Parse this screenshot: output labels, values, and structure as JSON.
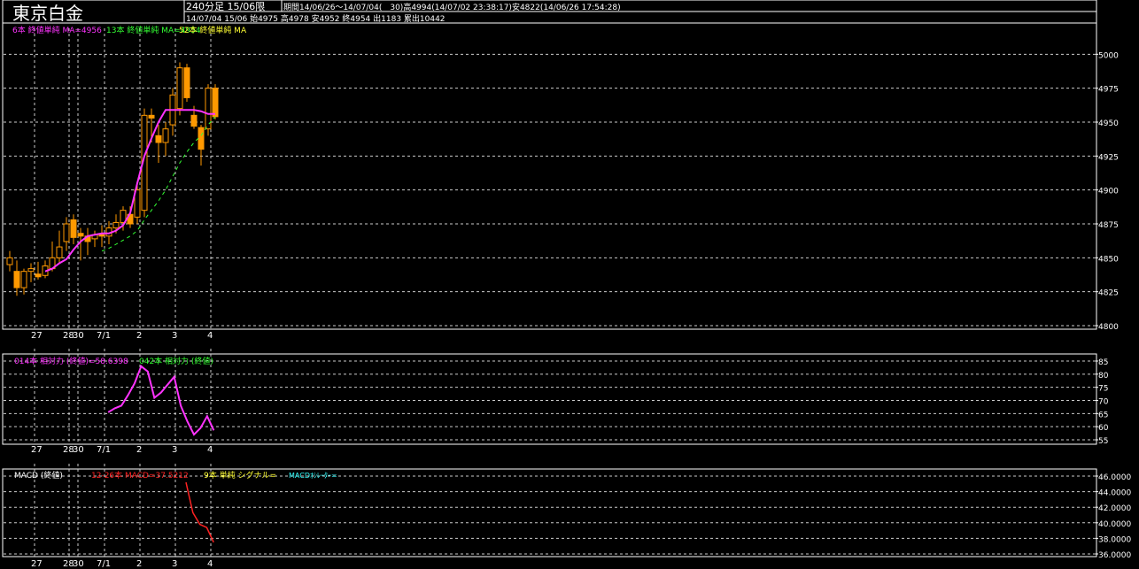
{
  "header": {
    "title": "東京白金",
    "timeframe": "240分足 15/06限",
    "period_info": "期間14/06/26～14/07/04(　30)高4994(14/07/02 23:38:17)安4822(14/06/26 17:54:28)",
    "last_bar": "14/07/04 15/06 始4975 高4978 安4952 終4954 出1183 累出10442"
  },
  "legends": {
    "price": [
      {
        "text": "6本 終値単純 MA=4956",
        "color": "#ff33ff"
      },
      {
        "text": "13本 終値単純 MA=4954",
        "color": "#33ff33"
      },
      {
        "text": "52本 終値単純 MA",
        "color": "#ffff33"
      }
    ],
    "rsi": [
      {
        "text": "014本 相対力 (終値)=58.6398",
        "color": "#ff33ff"
      },
      {
        "text": "042本 相対力 (終値)",
        "color": "#33ff33"
      }
    ],
    "macd": [
      {
        "text": "MACD (終値)",
        "color": "#ffffff"
      },
      {
        "text": "12-26本 MACD=37.5212",
        "color": "#ff2222"
      },
      {
        "text": "9本 単純 シグナル=",
        "color": "#ffff33"
      },
      {
        "text": "MACDｵｼﾚｰﾀｰ=",
        "color": "#33ffff"
      }
    ]
  },
  "colors": {
    "background": "#000000",
    "frame": "#ffffff",
    "grid": "#cccccc",
    "candle_down": "#ff9900",
    "candle_up_outline": "#ff9900",
    "ma_short": "#ff33ff",
    "ma_mid": "#33ff33",
    "rsi": "#ff33ff",
    "macd": "#ff2222"
  },
  "chart_data": [
    {
      "type": "candlestick",
      "panel": "price",
      "ylim": [
        4800,
        5010
      ],
      "y_ticks": [
        "5000",
        "4975",
        "4950",
        "4925",
        "4900",
        "4875",
        "4850",
        "4825",
        "4800"
      ],
      "x_labels": [
        "27",
        "28",
        "30",
        "7/1",
        "2",
        "3",
        "4"
      ],
      "grid": true,
      "candles": [
        {
          "o": 4845,
          "h": 4855,
          "l": 4840,
          "c": 4850
        },
        {
          "o": 4840,
          "h": 4848,
          "l": 4822,
          "c": 4828
        },
        {
          "o": 4828,
          "h": 4842,
          "l": 4823,
          "c": 4840
        },
        {
          "o": 4840,
          "h": 4846,
          "l": 4832,
          "c": 4842
        },
        {
          "o": 4838,
          "h": 4847,
          "l": 4834,
          "c": 4836
        },
        {
          "o": 4837,
          "h": 4848,
          "l": 4835,
          "c": 4844
        },
        {
          "o": 4842,
          "h": 4862,
          "l": 4840,
          "c": 4850
        },
        {
          "o": 4850,
          "h": 4870,
          "l": 4846,
          "c": 4858
        },
        {
          "o": 4862,
          "h": 4880,
          "l": 4855,
          "c": 4875
        },
        {
          "o": 4878,
          "h": 4882,
          "l": 4860,
          "c": 4865
        },
        {
          "o": 4868,
          "h": 4872,
          "l": 4848,
          "c": 4866
        },
        {
          "o": 4866,
          "h": 4872,
          "l": 4852,
          "c": 4862
        },
        {
          "o": 4864,
          "h": 4870,
          "l": 4858,
          "c": 4867
        },
        {
          "o": 4867,
          "h": 4874,
          "l": 4858,
          "c": 4866
        },
        {
          "o": 4866,
          "h": 4877,
          "l": 4860,
          "c": 4872
        },
        {
          "o": 4872,
          "h": 4882,
          "l": 4868,
          "c": 4876
        },
        {
          "o": 4876,
          "h": 4888,
          "l": 4870,
          "c": 4885
        },
        {
          "o": 4882,
          "h": 4888,
          "l": 4872,
          "c": 4875
        },
        {
          "o": 4880,
          "h": 4905,
          "l": 4875,
          "c": 4900
        },
        {
          "o": 4885,
          "h": 4960,
          "l": 4880,
          "c": 4955
        },
        {
          "o": 4955,
          "h": 4960,
          "l": 4935,
          "c": 4953
        },
        {
          "o": 4940,
          "h": 4948,
          "l": 4920,
          "c": 4935
        },
        {
          "o": 4935,
          "h": 4950,
          "l": 4925,
          "c": 4945
        },
        {
          "o": 4948,
          "h": 4975,
          "l": 4940,
          "c": 4970
        },
        {
          "o": 4960,
          "h": 4994,
          "l": 4955,
          "c": 4990
        },
        {
          "o": 4990,
          "h": 4993,
          "l": 4965,
          "c": 4968
        },
        {
          "o": 4955,
          "h": 4962,
          "l": 4945,
          "c": 4947
        },
        {
          "o": 4946,
          "h": 4948,
          "l": 4918,
          "c": 4930
        },
        {
          "o": 4945,
          "h": 4978,
          "l": 4940,
          "c": 4975
        },
        {
          "o": 4975,
          "h": 4978,
          "l": 4952,
          "c": 4954
        }
      ],
      "ma6": [
        null,
        null,
        null,
        null,
        null,
        4840,
        4842,
        4846,
        4849,
        4856,
        4862,
        4866,
        4867,
        4868,
        4868,
        4870,
        4874,
        4883,
        4905,
        4925,
        4938,
        4950,
        4959,
        4959,
        4959,
        4959,
        4959,
        4958,
        4956,
        4956
      ],
      "ma13": [
        null,
        null,
        null,
        null,
        null,
        null,
        null,
        null,
        null,
        null,
        null,
        null,
        null,
        4855,
        4857,
        4860,
        4863,
        4866,
        4870,
        4878,
        4885,
        4892,
        4900,
        4910,
        4920,
        4928,
        4935,
        4940,
        4948,
        4954
      ]
    },
    {
      "type": "line",
      "panel": "rsi",
      "ylim": [
        55,
        85
      ],
      "y_ticks": [
        "85",
        "80",
        "75",
        "70",
        "65",
        "60",
        "55"
      ],
      "x_labels": [
        "27",
        "28",
        "30",
        "7/1",
        "2",
        "3",
        "4"
      ],
      "grid": true,
      "values": [
        null,
        null,
        null,
        null,
        null,
        null,
        null,
        null,
        null,
        null,
        null,
        null,
        null,
        null,
        null,
        65.5,
        67,
        68,
        72,
        76.5,
        83,
        81,
        71,
        73,
        76,
        79,
        68,
        62,
        57,
        59.5,
        64,
        58.6
      ]
    },
    {
      "type": "line",
      "panel": "macd",
      "ylim": [
        36,
        46
      ],
      "y_ticks": [
        "46.0000",
        "44.0000",
        "42.0000",
        "40.0000",
        "38.0000",
        "36.0000"
      ],
      "x_labels": [
        "27",
        "28",
        "30",
        "7/1",
        "2",
        "3",
        "4"
      ],
      "grid": true,
      "values": [
        null,
        null,
        null,
        null,
        null,
        null,
        null,
        null,
        null,
        null,
        null,
        null,
        null,
        null,
        null,
        null,
        null,
        null,
        null,
        null,
        null,
        null,
        null,
        null,
        45.2,
        41.3,
        39.8,
        39.4,
        37.5
      ]
    }
  ]
}
